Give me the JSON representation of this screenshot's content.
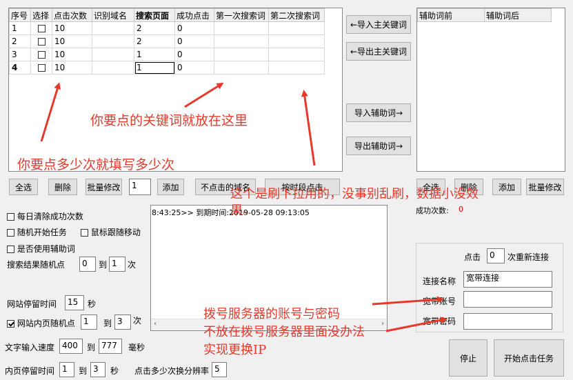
{
  "keyword_table": {
    "headers": [
      "序号",
      "选择",
      "点击次数",
      "识别域名",
      "搜索页面",
      "成功点击",
      "第一次搜索词",
      "第二次搜索词"
    ],
    "rows": [
      {
        "idx": "1",
        "count": "10",
        "domain": "",
        "page": "2",
        "success": "0"
      },
      {
        "idx": "2",
        "count": "10",
        "domain": "",
        "page": "2",
        "success": "0"
      },
      {
        "idx": "3",
        "count": "10",
        "domain": "",
        "page": "1",
        "success": "0"
      },
      {
        "idx": "4",
        "count": "10",
        "domain": "",
        "page": "1",
        "success": "0"
      }
    ]
  },
  "side_buttons": {
    "import_main": "←导入主关键词",
    "export_main": "←导出主关键词",
    "import_aux": "导入辅助词→",
    "export_aux": "导出辅助词→"
  },
  "aux_table": {
    "headers": [
      "辅助词前",
      "辅助词后"
    ]
  },
  "toolbar_left": {
    "select_all": "全选",
    "delete": "删除",
    "batch_edit": "批量修改",
    "qty_value": "1",
    "add": "添加",
    "no_click_domain": "不点击的域名",
    "timed_click": "按时段点击"
  },
  "toolbar_right": {
    "select_all": "全选",
    "delete": "删除",
    "add": "添加",
    "batch_edit": "批量修改"
  },
  "options": {
    "clear_daily": "每日清除成功次数",
    "random_start": "随机开始任务",
    "mouse_follow": "鼠标跟随移动",
    "use_aux": "是否使用辅助词",
    "random_click_label": "搜索结果随机点",
    "random_from": "0",
    "to_label": "到",
    "random_to": "1",
    "times_unit": "次",
    "stay_label": "网站停留时间",
    "stay_value": "15",
    "seconds_unit": "秒",
    "inner_random_label": "网站内页随机点",
    "inner_from": "1",
    "inner_to": "3",
    "typing_label": "文字输入速度",
    "typing_from": "400",
    "typing_to": "777",
    "ms_unit": "毫秒",
    "inner_stay_label": "内页停留时间",
    "inner_stay_from": "1",
    "inner_stay_to": "3",
    "resolution_label": "点击多少次换分辨率",
    "resolution_value": "5"
  },
  "log": {
    "line": "8:43:25>> 到期时间:2019-05-28 09:13:05"
  },
  "success_count": {
    "label": "成功次数:",
    "value": "0"
  },
  "dialer": {
    "click_label": "点击",
    "click_value": "0",
    "reconnect_label": "次重新连接",
    "conn_name_label": "连接名称",
    "conn_name_value": "宽带连接",
    "account_label": "宽带账号",
    "password_label": "宽带密码"
  },
  "actions": {
    "stop": "停止",
    "start": "开始点击任务"
  },
  "annotations": {
    "keyword_tip": "你要点的关键词就放在这里",
    "count_tip": "你要点多少次就填写多少次",
    "slider_tip": "这个是刷下拉用的，没事别乱刷，数据小没效果。",
    "dialer_tip_1": "拨号服务器的账号与密码",
    "dialer_tip_2": "不放在拨号服务器里面没办法",
    "dialer_tip_3": "实现更换IP"
  },
  "colors": {
    "annotation": "#e8382b",
    "success_value": "#e00000"
  }
}
